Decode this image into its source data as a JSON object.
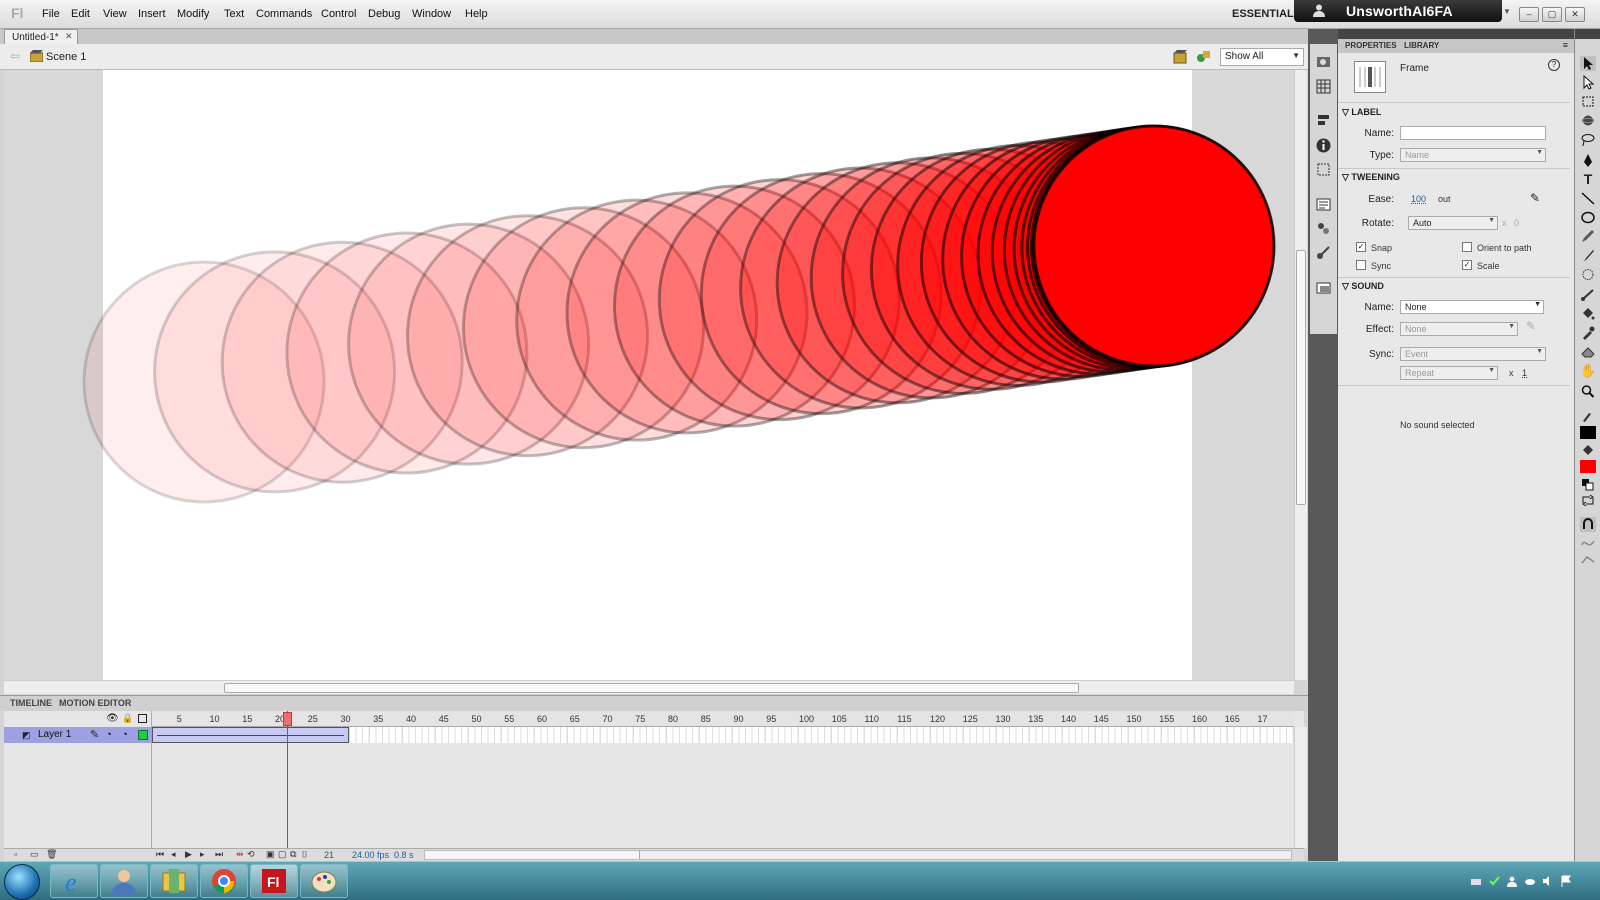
{
  "app": {
    "logo": "Fl",
    "menu": [
      "File",
      "Edit",
      "View",
      "Insert",
      "Modify",
      "Text",
      "Commands",
      "Control",
      "Debug",
      "Window",
      "Help"
    ],
    "workspace": "ESSENTIALS",
    "user": "UnsworthAI6FA",
    "window_buttons": [
      "–",
      "▢",
      "✕"
    ]
  },
  "document": {
    "tab": "Untitled-1*",
    "close": "✕",
    "scene": "Scene 1",
    "zoom": "Show All"
  },
  "stage": {
    "circle_color": "#ff0000",
    "circle_count": 30,
    "opacity_start": 0.12,
    "opacity_end": 1.0
  },
  "timeline": {
    "tabs": [
      "TIMELINE",
      "MOTION EDITOR"
    ],
    "layer": "Layer 1",
    "ticks": [
      "5",
      "10",
      "15",
      "20",
      "25",
      "30",
      "35",
      "40",
      "45",
      "50",
      "55",
      "60",
      "65",
      "70",
      "75",
      "80",
      "85",
      "90",
      "95",
      "100",
      "105",
      "110",
      "115",
      "120",
      "125",
      "130",
      "135",
      "140",
      "145",
      "150",
      "155",
      "160",
      "165",
      "17"
    ],
    "current_frame": "21",
    "fps": "24.00 fps",
    "time": "0.8 s",
    "tween_end_frame": 30
  },
  "properties": {
    "tabs": [
      "PROPERTIES",
      "LIBRARY"
    ],
    "type": "Frame",
    "label": {
      "title": "LABEL",
      "name_label": "Name:",
      "name_value": "",
      "type_label": "Type:",
      "type_value": "Name"
    },
    "tweening": {
      "title": "TWEENING",
      "ease_label": "Ease:",
      "ease_value": "100",
      "ease_suffix": "out",
      "rotate_label": "Rotate:",
      "rotate_value": "Auto",
      "rotate_x": "x",
      "rotate_count": "0",
      "snap": "Snap",
      "snap_checked": true,
      "orient": "Orient to path",
      "orient_checked": false,
      "sync": "Sync",
      "sync_checked": false,
      "scale": "Scale",
      "scale_checked": true
    },
    "sound": {
      "title": "SOUND",
      "name_label": "Name:",
      "name_value": "None",
      "effect_label": "Effect:",
      "effect_value": "None",
      "sync_label": "Sync:",
      "sync_value": "Event",
      "repeat_value": "Repeat",
      "repeat_x": "x",
      "repeat_count": "1",
      "status": "No sound selected"
    }
  },
  "colors": {
    "stroke": "#000000",
    "fill": "#ff0000"
  }
}
